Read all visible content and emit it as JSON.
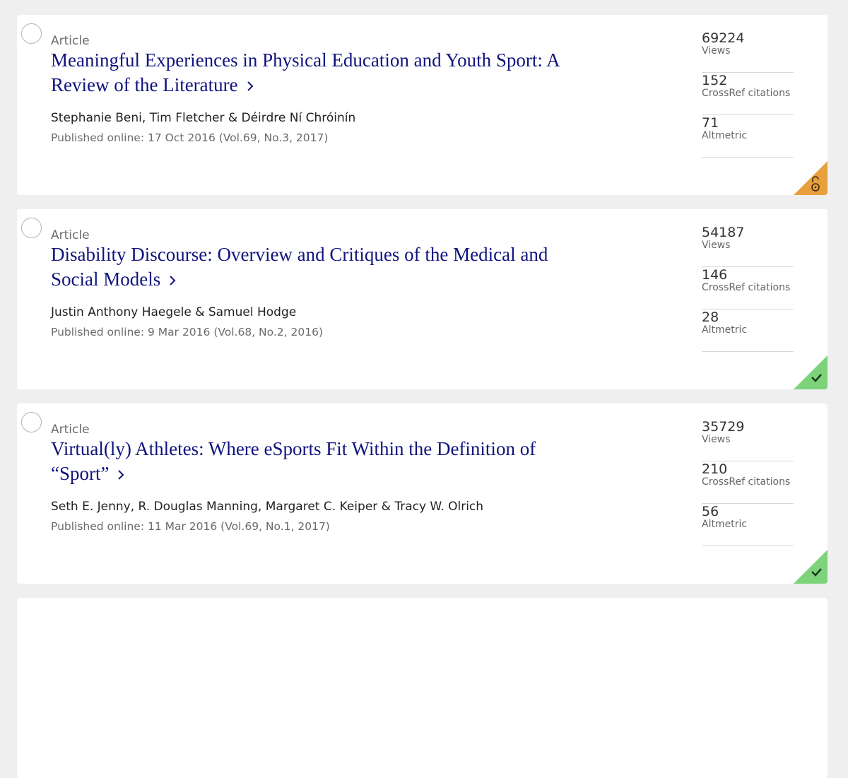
{
  "articles": [
    {
      "type": "Article",
      "title": "Meaningful Experiences in Physical Education and Youth Sport: A Review of the Literature",
      "authors": "Stephanie Beni, Tim Fletcher & Déirdre Ní Chróinín",
      "published": "Published online: 17 Oct 2016 (Vol.69, No.3, 2017)",
      "metrics": [
        {
          "value": "69224",
          "label": "Views"
        },
        {
          "value": "152",
          "label": "CrossRef citations"
        },
        {
          "value": "71",
          "label": "Altmetric"
        }
      ],
      "badge": {
        "icon": "open-access-icon",
        "color": "#e8a03d"
      }
    },
    {
      "type": "Article",
      "title": "Disability Discourse: Overview and Critiques of the Medical and Social Models",
      "authors": "Justin Anthony Haegele & Samuel Hodge",
      "published": "Published online: 9 Mar 2016 (Vol.68, No.2, 2016)",
      "metrics": [
        {
          "value": "54187",
          "label": "Views"
        },
        {
          "value": "146",
          "label": "CrossRef citations"
        },
        {
          "value": "28",
          "label": "Altmetric"
        }
      ],
      "badge": {
        "icon": "checkmark-icon",
        "color": "#7cd37a"
      }
    },
    {
      "type": "Article",
      "title": "Virtual(ly) Athletes: Where eSports Fit Within the Definition of “Sport”",
      "authors": "Seth E. Jenny, R. Douglas Manning, Margaret C. Keiper & Tracy W. Olrich",
      "published": "Published online: 11 Mar 2016 (Vol.69, No.1, 2017)",
      "metrics": [
        {
          "value": "35729",
          "label": "Views"
        },
        {
          "value": "210",
          "label": "CrossRef citations"
        },
        {
          "value": "56",
          "label": "Altmetric"
        }
      ],
      "badge": {
        "icon": "checkmark-icon",
        "color": "#7cd37a"
      }
    }
  ],
  "colors": {
    "title": "#10147e",
    "background": "#efefef",
    "open_access": "#e8a03d",
    "free_access": "#7cd37a"
  }
}
